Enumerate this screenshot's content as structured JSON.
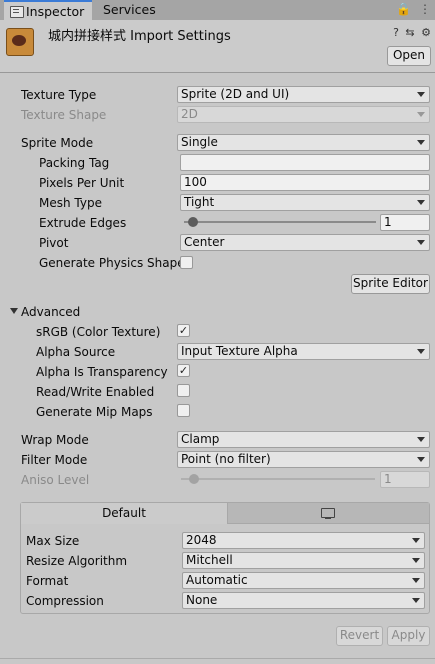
{
  "tabs": {
    "inspector": "Inspector",
    "services": "Services"
  },
  "strip_icons": {
    "lock": "🔒",
    "menu": "⋮"
  },
  "header": {
    "title": "城内拼接样式 Import Settings",
    "help": "?",
    "presets": "⇆",
    "settings": "⚙",
    "open_button": "Open"
  },
  "texture": {
    "type_label": "Texture Type",
    "type_value": "Sprite (2D and UI)",
    "shape_label": "Texture Shape",
    "shape_value": "2D",
    "sprite_mode_label": "Sprite Mode",
    "sprite_mode_value": "Single",
    "packing_tag_label": "Packing Tag",
    "packing_tag_value": "",
    "ppu_label": "Pixels Per Unit",
    "ppu_value": "100",
    "mesh_type_label": "Mesh Type",
    "mesh_type_value": "Tight",
    "extrude_label": "Extrude Edges",
    "extrude_value": "1",
    "extrude_fraction": 0.03,
    "pivot_label": "Pivot",
    "pivot_value": "Center",
    "physics_label": "Generate Physics Shape",
    "physics_checked": false,
    "sprite_editor_button": "Sprite Editor"
  },
  "advanced": {
    "label": "Advanced",
    "srgb_label": "sRGB (Color Texture)",
    "srgb_check": "✓",
    "alpha_source_label": "Alpha Source",
    "alpha_source_value": "Input Texture Alpha",
    "alpha_trans_label": "Alpha Is Transparency",
    "alpha_trans_check": "✓",
    "readwrite_label": "Read/Write Enabled",
    "readwrite_check": "",
    "mipmaps_label": "Generate Mip Maps",
    "mipmaps_check": ""
  },
  "filtering": {
    "wrap_label": "Wrap Mode",
    "wrap_value": "Clamp",
    "filter_label": "Filter Mode",
    "filter_value": "Point (no filter)",
    "aniso_label": "Aniso Level",
    "aniso_value": "1"
  },
  "platform": {
    "default_tab": "Default",
    "monitor_tab_icon": "monitor-icon",
    "max_size_label": "Max Size",
    "max_size_value": "2048",
    "resize_label": "Resize Algorithm",
    "resize_value": "Mitchell",
    "format_label": "Format",
    "format_value": "Automatic",
    "compression_label": "Compression",
    "compression_value": "None"
  },
  "footer": {
    "revert": "Revert",
    "apply": "Apply"
  }
}
